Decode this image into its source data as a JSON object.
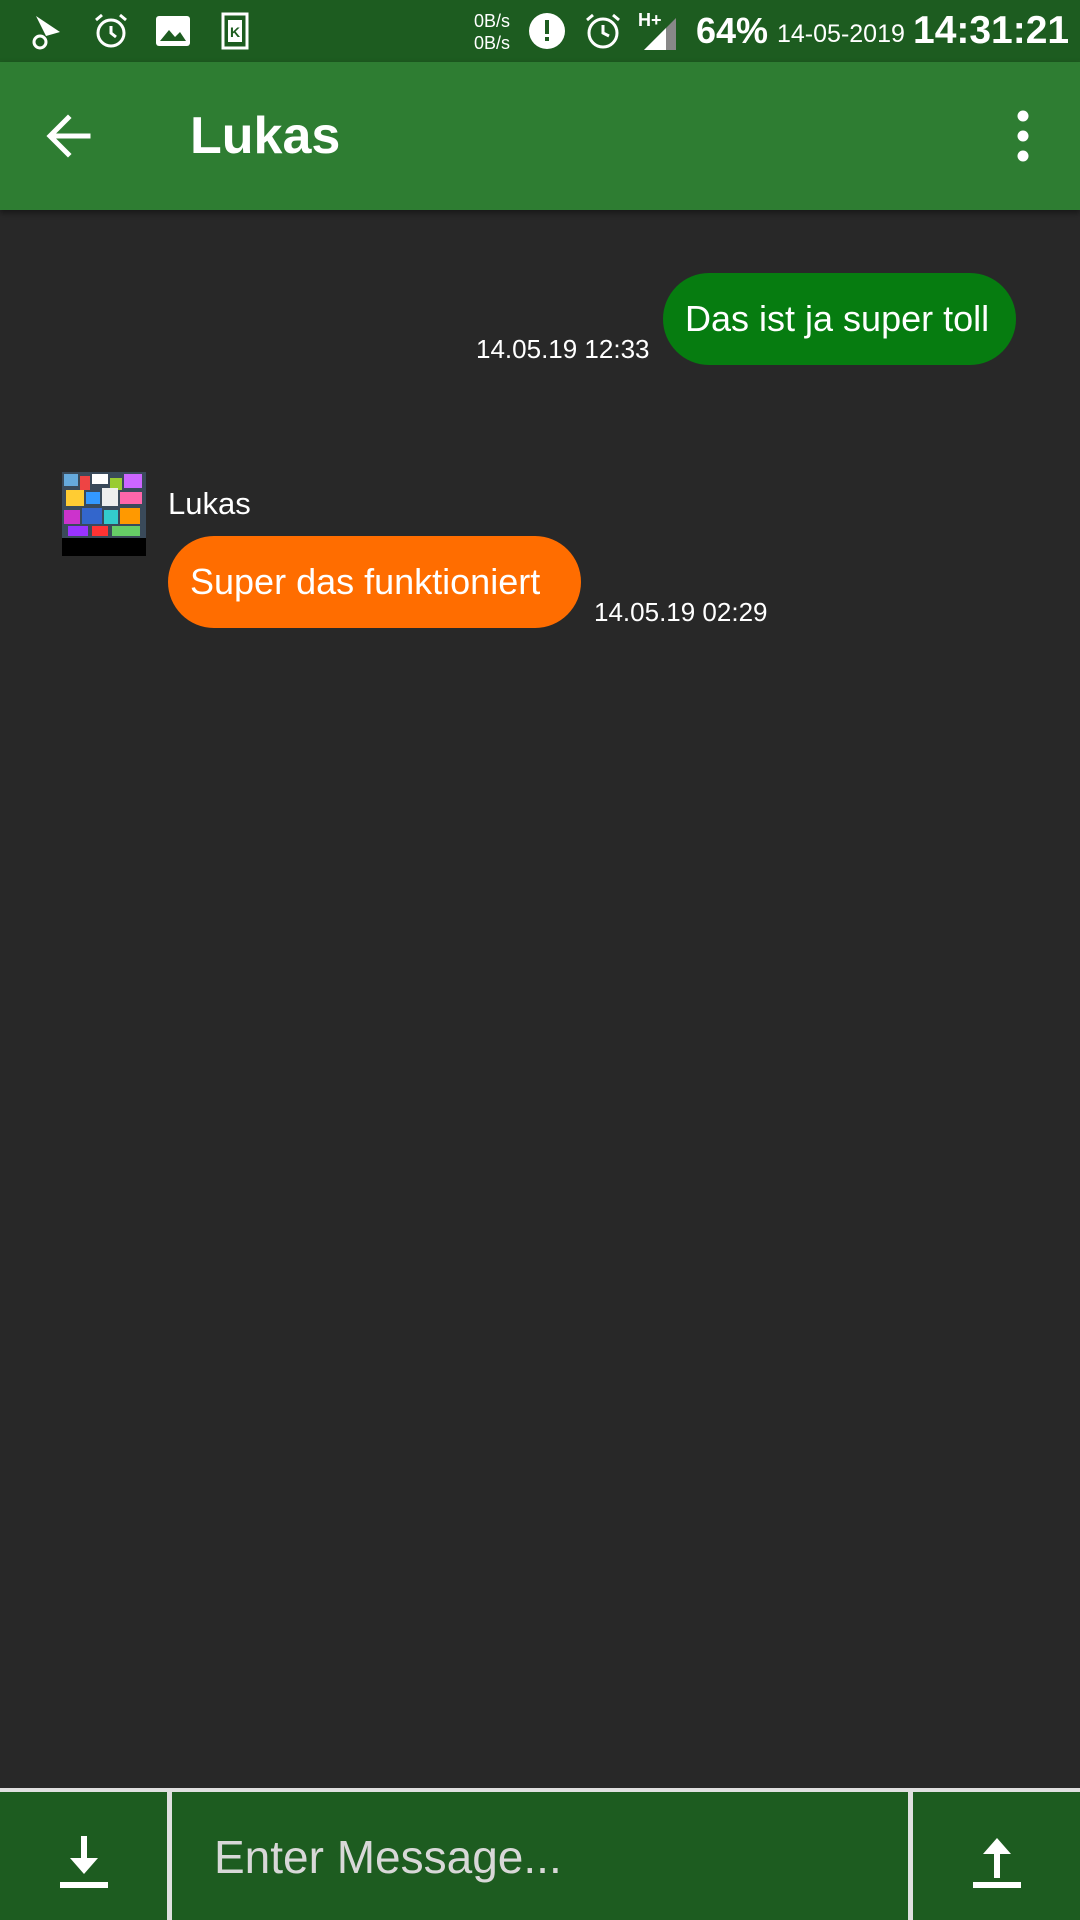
{
  "status_bar": {
    "net_up": "0B/s",
    "net_down": "0B/s",
    "network_type": "H+",
    "battery": "64%",
    "date": "14-05-2019",
    "time": "14:31:21",
    "icons": [
      "location-pin-icon",
      "alarm-icon",
      "image-icon",
      "k-app-icon",
      "alert-icon",
      "alarm-clock-icon",
      "signal-icon"
    ]
  },
  "app_bar": {
    "title": "Lukas",
    "color": "#2e7d32"
  },
  "messages": [
    {
      "direction": "outgoing",
      "text": "Das ist ja super toll",
      "timestamp": "14.05.19 12:33",
      "color": "#067c10"
    },
    {
      "direction": "incoming",
      "sender": "Lukas",
      "text": "Super das funktioniert",
      "timestamp": "14.05.19 02:29",
      "color": "#ff6d00"
    }
  ],
  "input": {
    "placeholder": "Enter Message...",
    "value": ""
  },
  "colors": {
    "background": "#282828",
    "status_bar": "#1d5c20",
    "bottom_bar": "#1d5c20"
  }
}
